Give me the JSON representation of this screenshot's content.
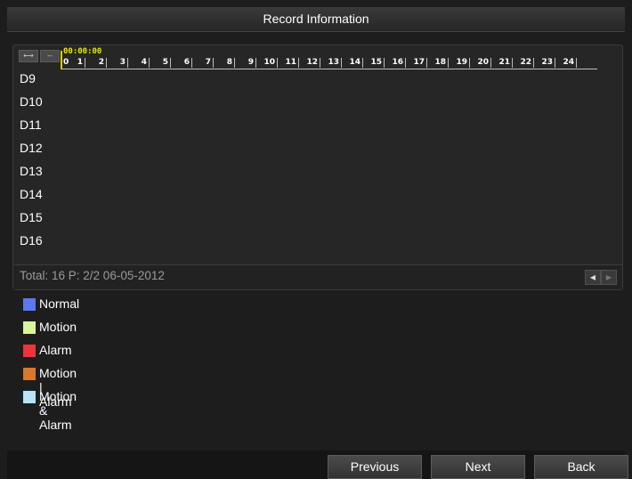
{
  "window": {
    "title": "Record Information"
  },
  "timeline": {
    "cursor_time": "00:00:00",
    "hours": [
      "0",
      "1",
      "2",
      "3",
      "4",
      "5",
      "6",
      "7",
      "8",
      "9",
      "10",
      "11",
      "12",
      "13",
      "14",
      "15",
      "16",
      "17",
      "18",
      "19",
      "20",
      "21",
      "22",
      "23",
      "24"
    ],
    "expand_icon": "expand-arrows-icon",
    "collapse_icon": "collapse-arrows-icon"
  },
  "channels": [
    "D9",
    "D10",
    "D11",
    "D12",
    "D13",
    "D14",
    "D15",
    "D16"
  ],
  "footer": {
    "status": "Total: 16  P: 2/2 06-05-2012"
  },
  "legend": [
    {
      "label": "Normal",
      "color": "#5b78f0"
    },
    {
      "label": "Motion",
      "color": "#d8f79a"
    },
    {
      "label": "Alarm",
      "color": "#e8363a"
    },
    {
      "label": "Motion | Alarm",
      "color": "#d8782c"
    },
    {
      "label": "Motion & Alarm",
      "color": "#b8e2f8"
    }
  ],
  "buttons": {
    "previous": "Previous",
    "next": "Next",
    "back": "Back"
  }
}
